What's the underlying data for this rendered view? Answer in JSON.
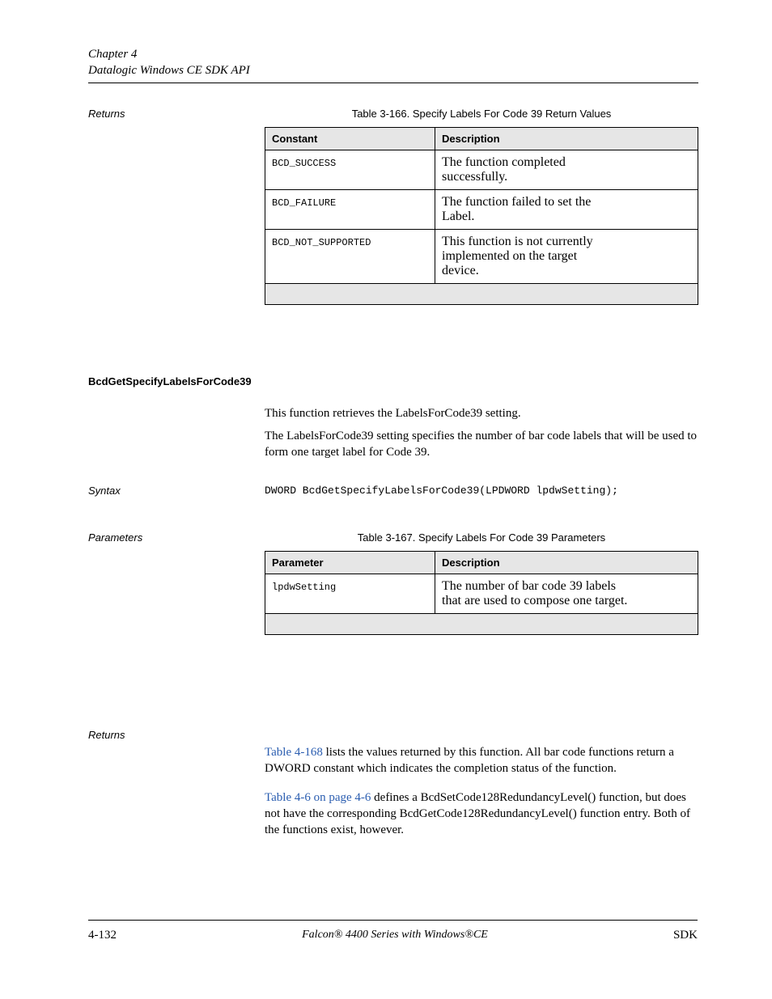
{
  "header": {
    "chapter_line": "Chapter 4",
    "subject_line": "Datalogic Windows CE SDK API"
  },
  "section1": {
    "returns_label": "Returns",
    "table_caption": "Table 3-166. Specify Labels For Code 39 Return Values",
    "columns": [
      "Constant",
      "Description"
    ],
    "rows": [
      {
        "constant": "BCD_SUCCESS",
        "desc_lines": [
          "The function completed",
          "successfully."
        ]
      },
      {
        "constant": "BCD_FAILURE",
        "desc_lines": [
          "The function failed to set the",
          "Label."
        ]
      },
      {
        "constant": "BCD_NOT_SUPPORTED",
        "desc_lines": [
          "This function is not currently",
          "implemented on the target",
          "device."
        ]
      }
    ]
  },
  "section2": {
    "heading": "BcdGetSpecifyLabelsForCode39",
    "para_leadin": "This function retrieves the LabelsForCode39 setting.",
    "para_rest": "The LabelsForCode39 setting specifies the number of bar code labels that will be used to form one target label for Code 39.",
    "syntax_label": "Syntax",
    "syntax_code": "DWORD BcdGetSpecifyLabelsForCode39(LPDWORD lpdwSetting);",
    "parameters_label": "Parameters",
    "param_table_caption": "Table 3-167. Specify Labels For Code 39 Parameters",
    "columns": [
      "Parameter",
      "Description"
    ],
    "rows": [
      {
        "parameter": "lpdwSetting",
        "desc_lines": [
          "The number of bar code 39 labels",
          "that are used to compose one target."
        ]
      }
    ]
  },
  "section3": {
    "returns_label": "Returns",
    "para1_leadin": "Table 4-168",
    "para1_rest": " lists the values returned by this function. All bar code functions return a DWORD constant which indicates the completion status of the function.",
    "para2_leadin": "Table 4-6 on page 4-6",
    "para2_rest": " defines a BcdSetCode128RedundancyLevel() function, but does not have the corresponding BcdGetCode128RedundancyLevel() function entry. Both of the functions exist, however."
  },
  "footer": {
    "left": "4-132",
    "mid": "Falcon® 4400 Series with Windows®CE",
    "right": "SDK"
  }
}
